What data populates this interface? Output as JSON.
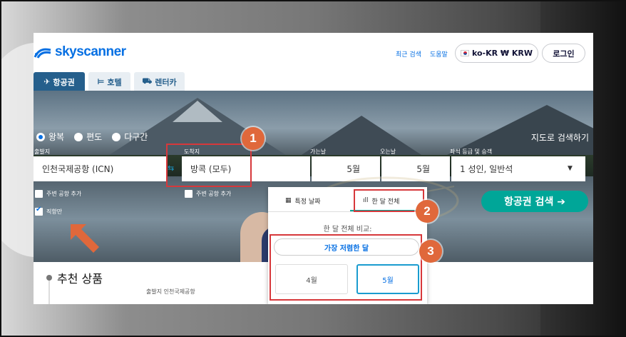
{
  "header": {
    "brand": "skyscanner",
    "links": {
      "recent": "최근 검색",
      "help": "도움말"
    },
    "locale_button": "ko-KR ₩ KRW",
    "login_button": "로그인"
  },
  "tabs": [
    {
      "label": "항공권",
      "icon": "plane-icon"
    },
    {
      "label": "호텔",
      "icon": "bed-icon"
    },
    {
      "label": "렌터카",
      "icon": "car-icon"
    }
  ],
  "trip_types": [
    "왕복",
    "편도",
    "다구간"
  ],
  "map_search": "지도로 검색하기",
  "form": {
    "from_label": "출발지",
    "from_value": "인천국제공항 (ICN)",
    "to_label": "도착지",
    "to_value": "방콕 (모두)",
    "depart_label": "가는날",
    "depart_value": "5월",
    "return_label": "오는날",
    "return_value": "5월",
    "cabin_label": "좌석 등급 및 승객",
    "cabin_value": "1 성인, 일반석",
    "nearby_from": "주변 공항 추가",
    "nearby_to": "주변 공항 추가",
    "direct_only": "직항만",
    "search_button": "항공권 검색 ➔"
  },
  "date_panel": {
    "tab_specific": "특정 날짜",
    "tab_whole_month": "한 달 전체",
    "compare_label": "한 달 전체 비교:",
    "cheapest_button": "가장 저렴한 달",
    "months": [
      "4월",
      "5월"
    ]
  },
  "recommendations": {
    "title": "추천 상품",
    "subtitle": "출발지 인천국제공항"
  },
  "callouts": [
    "1",
    "2",
    "3"
  ],
  "colors": {
    "brand_blue": "#0770e3",
    "tab_active": "#255f8c",
    "search_green": "#00a698",
    "highlight_red": "#d7383b",
    "callout_orange": "#e0683b"
  }
}
